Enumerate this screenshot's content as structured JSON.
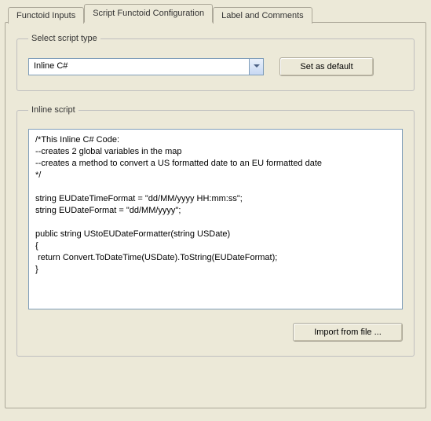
{
  "tabs": {
    "inputs_label": "Functoid Inputs",
    "config_label": "Script Functoid Configuration",
    "labelcomments_label": "Label and Comments"
  },
  "scripttype_group": {
    "legend": "Select script type",
    "selected_value": "Inline C#",
    "set_default_label": "Set as default"
  },
  "inlinescript_group": {
    "legend": "Inline script",
    "import_label": "Import from file ...",
    "code": "/*This Inline C# Code:\n--creates 2 global variables in the map\n--creates a method to convert a US formatted date to an EU formatted date\n*/\n\nstring EUDateTimeFormat = \"dd/MM/yyyy HH:mm:ss\";\nstring EUDateFormat = \"dd/MM/yyyy\";\n\npublic string UStoEUDateFormatter(string USDate)\n{\n return Convert.ToDateTime(USDate).ToString(EUDateFormat);\n}"
  }
}
